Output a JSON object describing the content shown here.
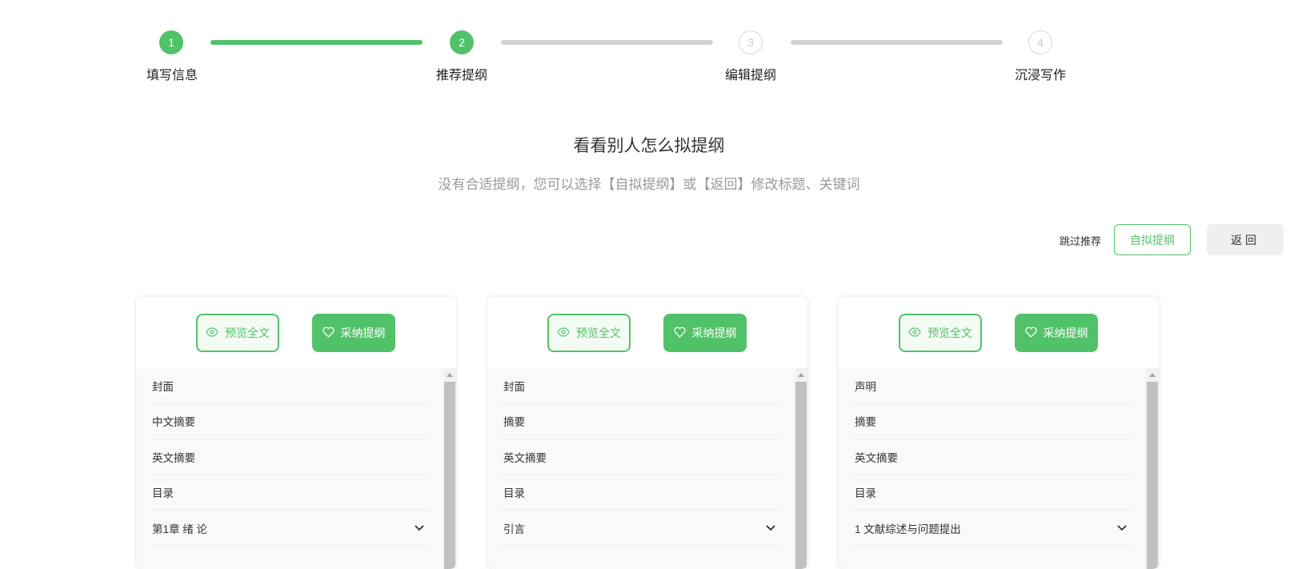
{
  "steps": [
    {
      "num": "1",
      "label": "填写信息",
      "state": "done"
    },
    {
      "num": "2",
      "label": "推荐提纲",
      "state": "done"
    },
    {
      "num": "3",
      "label": "编辑提纲",
      "state": "todo"
    },
    {
      "num": "4",
      "label": "沉浸写作",
      "state": "todo"
    }
  ],
  "heading": {
    "title": "看看别人怎么拟提纲",
    "subtitle": "没有合适提纲，您可以选择【自拟提纲】或【返回】修改标题、关键词"
  },
  "actions": {
    "skip": "跳过推荐",
    "own": "自拟提纲",
    "back": "返回"
  },
  "cards": [
    {
      "preview": "预览全文",
      "adopt": "采纳提纲",
      "items": [
        "封面",
        "中文摘要",
        "英文摘要",
        "目录",
        "第1章 绪 论"
      ]
    },
    {
      "preview": "预览全文",
      "adopt": "采纳提纲",
      "items": [
        "封面",
        "摘要",
        "英文摘要",
        "目录",
        "引言"
      ]
    },
    {
      "preview": "预览全文",
      "adopt": "采纳提纲",
      "items": [
        "声明",
        "摘要",
        "英文摘要",
        "目录",
        "1 文献综述与问题提出"
      ]
    }
  ],
  "colors": {
    "accent": "#52c26a"
  }
}
